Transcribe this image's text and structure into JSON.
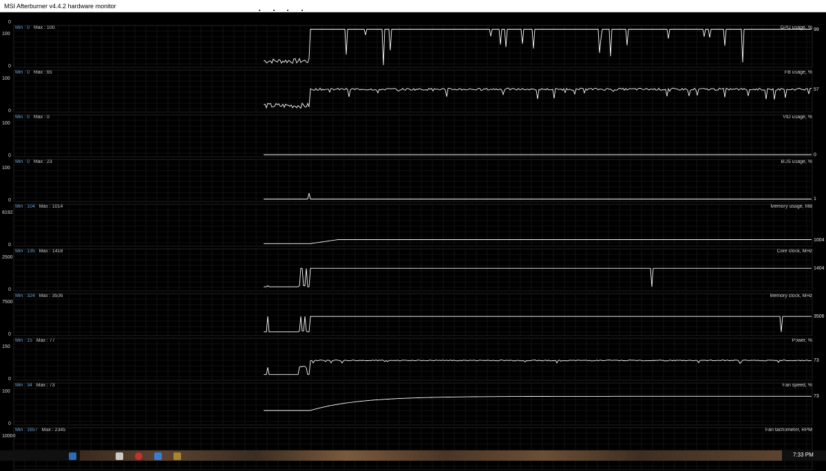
{
  "window": {
    "title": "MSI Afterburner v4.4.2 hardware monitor"
  },
  "header": {
    "first_scale_bottom": "0"
  },
  "graphs": [
    {
      "name": "GPU usage, %",
      "min_label": "Min : 0",
      "max_label": "Max : 100",
      "scale_top": "100",
      "scale_bottom": "0",
      "current": "99",
      "scale_max": 100,
      "initial": 5,
      "steady": 99,
      "rise_at": 0.06,
      "noise": "spiky"
    },
    {
      "name": "FB usage, %",
      "min_label": "Min : 0",
      "max_label": "Max : 65",
      "scale_top": "100",
      "scale_bottom": "0",
      "current": "57",
      "scale_max": 100,
      "initial": 5,
      "steady": 57,
      "rise_at": 0.06,
      "noise": "noisy"
    },
    {
      "name": "VID usage, %",
      "min_label": "Min : 0",
      "max_label": "Max : 0",
      "scale_top": "100",
      "scale_bottom": "0",
      "current": "0",
      "scale_max": 100,
      "initial": 0,
      "steady": 0,
      "rise_at": 0.06,
      "noise": "flat"
    },
    {
      "name": "BUS usage, %",
      "min_label": "Min : 0",
      "max_label": "Max : 23",
      "scale_top": "100",
      "scale_bottom": "0",
      "current": "1",
      "scale_max": 100,
      "initial": 1,
      "steady": 1,
      "rise_at": 0.06,
      "noise": "bus"
    },
    {
      "name": "Memory usage, MB",
      "min_label": "Min : 104",
      "max_label": "Max : 1014",
      "scale_top": "8192",
      "scale_bottom": "0",
      "current": "1004",
      "scale_max": 8192,
      "initial": 104,
      "steady": 1004,
      "rise_at": 0.06,
      "noise": "smooth"
    },
    {
      "name": "Core clock, MHz",
      "min_label": "Min : 135",
      "max_label": "Max : 1418",
      "scale_top": "2500",
      "scale_bottom": "0",
      "current": "1404",
      "scale_max": 2500,
      "initial": 135,
      "steady": 1404,
      "rise_at": 0.06,
      "noise": "clock"
    },
    {
      "name": "Memory clock, MHz",
      "min_label": "Min : 324",
      "max_label": "Max : 3506",
      "scale_top": "7500",
      "scale_bottom": "0",
      "current": "3506",
      "scale_max": 7500,
      "initial": 324,
      "steady": 3506,
      "rise_at": 0.06,
      "noise": "clock"
    },
    {
      "name": "Power, %",
      "min_label": "Min : 15",
      "max_label": "Max : 77",
      "scale_top": "150",
      "scale_bottom": "0",
      "current": "73",
      "scale_max": 150,
      "initial": 15,
      "steady": 73,
      "rise_at": 0.06,
      "noise": "power"
    },
    {
      "name": "Fan speed, %",
      "min_label": "Min : 34",
      "max_label": "Max : 73",
      "scale_top": "100",
      "scale_bottom": "0",
      "current": "73",
      "scale_max": 100,
      "initial": 34,
      "steady": 73,
      "rise_at": 0.06,
      "noise": "fan"
    },
    {
      "name": "Fan tachometer, RPM",
      "min_label": "Min : 1657",
      "max_label": "Max : 2345",
      "scale_top": "10000",
      "scale_bottom": "0",
      "current": "",
      "scale_max": 10000,
      "initial": 1657,
      "steady": 2345,
      "rise_at": 0.06,
      "noise": "none"
    }
  ],
  "taskbar": {
    "clock": "7:33 PM"
  },
  "colors": {
    "background": "#000000",
    "grid": "#1f1f1f",
    "line": "#ffffff",
    "min_label": "#6fa8d8"
  }
}
